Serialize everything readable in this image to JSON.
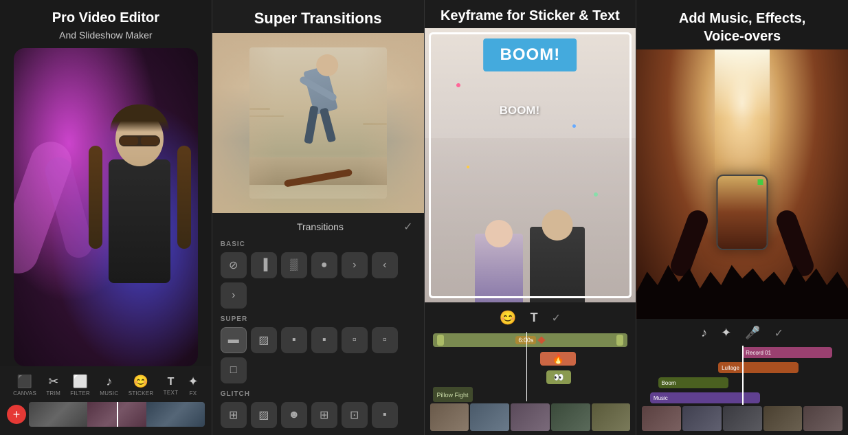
{
  "panels": [
    {
      "id": "panel-1",
      "title_line1": "Pro Video Editor",
      "title_line2": "And Slideshow Maker",
      "toolbar": {
        "tools": [
          {
            "icon": "🎬",
            "label": "CANVAS"
          },
          {
            "icon": "✂️",
            "label": "TRIM"
          },
          {
            "icon": "🎨",
            "label": "FILTER"
          },
          {
            "icon": "🎵",
            "label": "MUSIC"
          },
          {
            "icon": "😊",
            "label": "STICKER"
          },
          {
            "icon": "T",
            "label": "TEXT"
          },
          {
            "icon": "✨",
            "label": "FX"
          }
        ],
        "add_label": "+"
      }
    },
    {
      "id": "panel-2",
      "title": "Super Transitions",
      "transitions_label": "Transitions",
      "sections": [
        {
          "label": "BASIC",
          "icons": [
            "⊘",
            "▐",
            "▒",
            "●",
            "›",
            "‹",
            "›"
          ]
        },
        {
          "label": "SUPER",
          "icons": [
            "▬",
            "▨",
            "▪",
            "▪",
            "▪",
            "▫",
            "▫"
          ]
        },
        {
          "label": "GLITCH",
          "icons": [
            "⊞",
            "▨",
            "☻",
            "⊞",
            "⊡",
            "▪",
            "⊞"
          ]
        }
      ]
    },
    {
      "id": "panel-3",
      "title_normal": " for Sticker & Text",
      "title_bold": "Keyframe",
      "boom_text_1": "BOOM!",
      "boom_text_2": "BOOM!",
      "track_label": "Pillow Fight"
    },
    {
      "id": "panel-4",
      "title_line1": "Add ",
      "title_bold": "Music, Effects,",
      "title_line2": "Voice-overs",
      "tracks": [
        {
          "label": "Record 01",
          "color": "#a05080",
          "offset": 55
        },
        {
          "label": "Lullage",
          "color": "#b06030",
          "offset": 40
        },
        {
          "label": "Boom",
          "color": "#5a7030",
          "offset": 10
        },
        {
          "label": "Music",
          "color": "#7050a0",
          "offset": 0
        }
      ]
    }
  ]
}
